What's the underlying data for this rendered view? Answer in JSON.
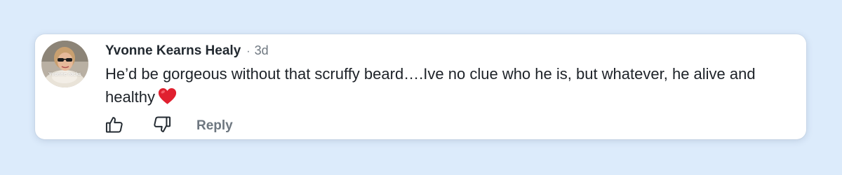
{
  "comment": {
    "author": "Yvonne Kearns Healy",
    "separator": "·",
    "age": "3d",
    "text": "He’d be gorgeous without that scruffy beard….Ive no clue who he is, but whatever, he alive and healthy",
    "emoji": "heart-emoji",
    "avatar_caption": "Yvonne rocks"
  },
  "actions": {
    "like_icon": "thumbs-up-icon",
    "dislike_icon": "thumbs-down-icon",
    "reply_label": "Reply"
  },
  "colors": {
    "page_background": "#dcebfb",
    "card_background": "#ffffff",
    "author_text": "#232a31",
    "muted_text": "#6e7780",
    "heart": "#e0202f"
  }
}
